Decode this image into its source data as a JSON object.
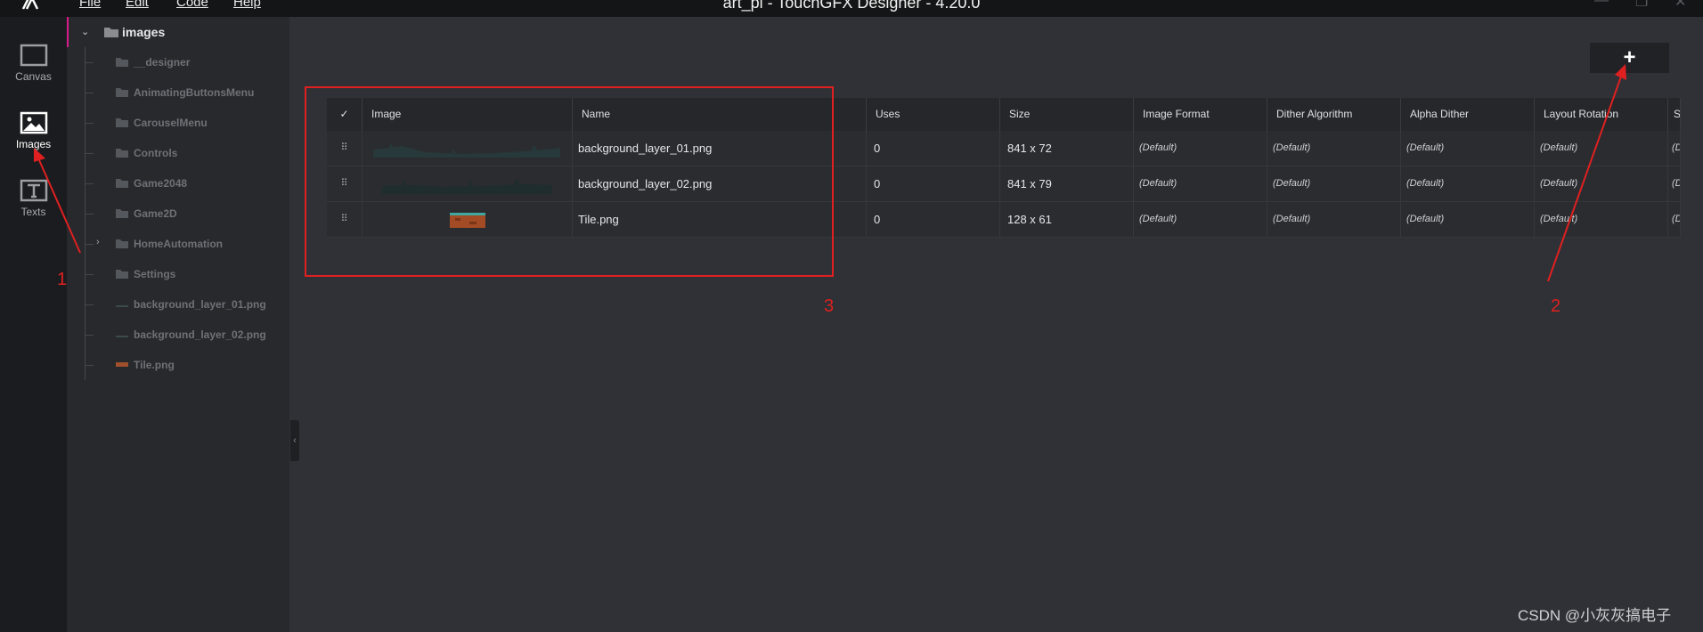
{
  "menu": {
    "file": "File",
    "edit": "Edit",
    "code": "Code",
    "help": "Help"
  },
  "window_title": "art_pi - TouchGFX Designer - 4.20.0",
  "rail": [
    {
      "label": "Canvas",
      "icon": "canvas-icon"
    },
    {
      "label": "Images",
      "icon": "images-icon"
    },
    {
      "label": "Texts",
      "icon": "texts-icon"
    }
  ],
  "tree": {
    "root": "images",
    "items": [
      {
        "label": "__designer",
        "type": "folder"
      },
      {
        "label": "AnimatingButtonsMenu",
        "type": "folder"
      },
      {
        "label": "CarouselMenu",
        "type": "folder"
      },
      {
        "label": "Controls",
        "type": "folder"
      },
      {
        "label": "Game2048",
        "type": "folder"
      },
      {
        "label": "Game2D",
        "type": "folder"
      },
      {
        "label": "HomeAutomation",
        "type": "folder"
      },
      {
        "label": "Settings",
        "type": "folder"
      },
      {
        "label": "background_layer_01.png",
        "type": "file"
      },
      {
        "label": "background_layer_02.png",
        "type": "file"
      },
      {
        "label": "Tile.png",
        "type": "file"
      }
    ]
  },
  "add_button": "+",
  "table": {
    "headers": [
      "Image",
      "Name",
      "Uses",
      "Size",
      "Image Format",
      "Dither Algorithm",
      "Alpha Dither",
      "Layout Rotation",
      "S"
    ],
    "rows": [
      {
        "name": "background_layer_01.png",
        "uses": "0",
        "size": "841 x 72",
        "image_format": "(Default)",
        "dither_algorithm": "(Default)",
        "alpha_dither": "(Default)",
        "layout_rotation": "(Default)",
        "extra": "(D"
      },
      {
        "name": "background_layer_02.png",
        "uses": "0",
        "size": "841 x 79",
        "image_format": "(Default)",
        "dither_algorithm": "(Default)",
        "alpha_dither": "(Default)",
        "layout_rotation": "(Default)",
        "extra": "(D"
      },
      {
        "name": "Tile.png",
        "uses": "0",
        "size": "128 x 61",
        "image_format": "(Default)",
        "dither_algorithm": "(Default)",
        "alpha_dither": "(Default)",
        "layout_rotation": "(Default)",
        "extra": "(D"
      }
    ]
  },
  "annotations": {
    "one": "1",
    "two": "2",
    "three": "3"
  },
  "watermark": "CSDN @小灰灰搞电子",
  "colors": {
    "accent": "#d81b8c",
    "annotation": "#e02020",
    "background": "#2f3136"
  }
}
